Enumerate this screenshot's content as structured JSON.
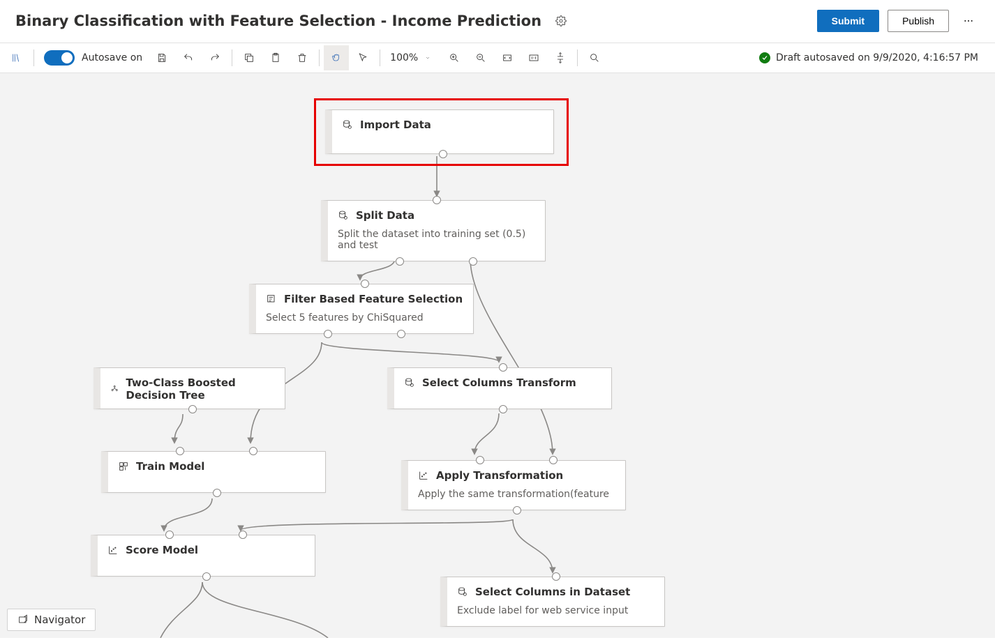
{
  "header": {
    "title": "Binary Classification with Feature Selection - Income Prediction",
    "settings_icon": "gear-icon",
    "submit": "Submit",
    "publish": "Publish",
    "more_icon": "more-icon"
  },
  "toolbar": {
    "autosave_label": "Autosave on",
    "zoom_value": "100%",
    "status_text": "Draft autosaved on 9/9/2020, 4:16:57 PM"
  },
  "nodes": {
    "import_data": {
      "title": "Import Data"
    },
    "split_data": {
      "title": "Split Data",
      "sub": "Split the dataset into training set (0.5) and test"
    },
    "filter_fs": {
      "title": "Filter Based Feature Selection",
      "sub": "Select 5 features by ChiSquared"
    },
    "boosted_tree": {
      "title": "Two-Class Boosted Decision Tree"
    },
    "select_cols_tf": {
      "title": "Select Columns Transform"
    },
    "train_model": {
      "title": "Train Model"
    },
    "apply_tf": {
      "title": "Apply Transformation",
      "sub": "Apply the same transformation(feature"
    },
    "score_model": {
      "title": "Score Model"
    },
    "select_cols_ds": {
      "title": "Select Columns in Dataset",
      "sub": "Exclude label for web service input"
    }
  },
  "navigator": {
    "label": "Navigator"
  }
}
